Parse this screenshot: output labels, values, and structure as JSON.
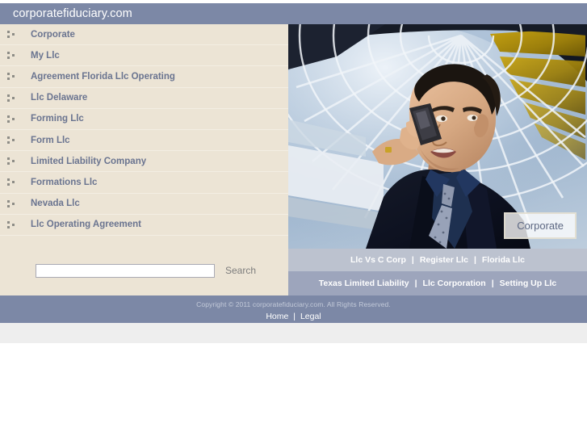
{
  "header": {
    "site_title": "corporatefiduciary.com",
    "background_color": "#7c88a6"
  },
  "sidebar": {
    "background_color": "#ece4d5",
    "bullet_icon": "three-squares-icon",
    "items": [
      {
        "label": "Corporate"
      },
      {
        "label": "My Llc"
      },
      {
        "label": "Agreement Florida Llc Operating"
      },
      {
        "label": "Llc Delaware"
      },
      {
        "label": "Forming Llc"
      },
      {
        "label": "Form Llc"
      },
      {
        "label": "Limited Liability Company"
      },
      {
        "label": "Formations Llc"
      },
      {
        "label": "Nevada Llc"
      },
      {
        "label": "Llc Operating Agreement"
      }
    ],
    "search": {
      "value": "",
      "placeholder": "",
      "button_label": "Search"
    }
  },
  "hero": {
    "caption": "Corporate",
    "image_alt": "businessman-on-mobile-phone-under-glass-atrium"
  },
  "link_bars": [
    {
      "background_color": "#bcc2cf",
      "links": [
        "Llc Vs C Corp",
        "Register Llc",
        "Florida Llc"
      ],
      "separator": "|"
    },
    {
      "background_color": "#9da5bc",
      "links": [
        "Texas Limited Liability",
        "Llc Corporation",
        "Setting Up Llc"
      ],
      "separator": "|"
    }
  ],
  "footer": {
    "copyright": "Copyright © 2011 corporatefiduciary.com. All Rights Reserved.",
    "links": [
      "Home",
      "Legal"
    ],
    "separator": "|",
    "background_color": "#7c88a6"
  }
}
